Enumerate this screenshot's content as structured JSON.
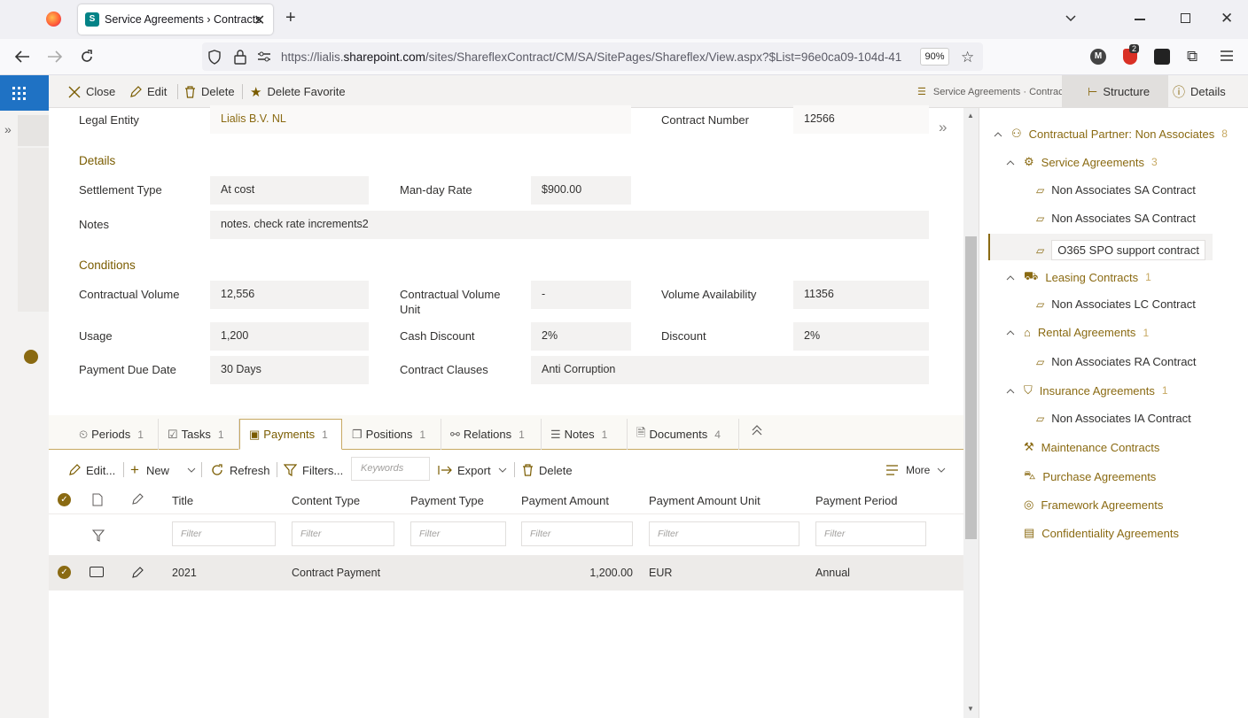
{
  "browser": {
    "tab_title": "Service Agreements › Contracts",
    "url_prefix": "https://lialis.",
    "url_domain": "sharepoint.com",
    "url_suffix": "/sites/ShareflexContract/CM/SA/SitePages/Shareflex/View.aspx?$List=96e0ca09-104d-41",
    "zoom": "90%",
    "ext_badge": "2",
    "profile_initial": "M"
  },
  "commands": {
    "close": "Close",
    "edit": "Edit",
    "delete": "Delete",
    "delete_favorite": "Delete Favorite",
    "breadcrumb": "Service Agreements · Contracts",
    "structure": "Structure",
    "details": "Details"
  },
  "form": {
    "legal_entity_label": "Legal Entity",
    "legal_entity_value": "Lialis B.V. NL",
    "contract_number_label": "Contract Number",
    "contract_number_value": "12566",
    "details_heading": "Details",
    "settlement_type_label": "Settlement Type",
    "settlement_type_value": "At cost",
    "manday_rate_label": "Man-day Rate",
    "manday_rate_value": "$900.00",
    "notes_label": "Notes",
    "notes_value": "notes. check rate increments2",
    "conditions_heading": "Conditions",
    "contractual_volume_label": "Contractual Volume",
    "contractual_volume_value": "12,556",
    "cv_unit_label_1": "Contractual Volume",
    "cv_unit_label_2": "Unit",
    "cv_unit_value": "-",
    "volume_availability_label": "Volume Availability",
    "volume_availability_value": "11356",
    "usage_label": "Usage",
    "usage_value": "1,200",
    "cash_discount_label": "Cash Discount",
    "cash_discount_value": "2%",
    "discount_label": "Discount",
    "discount_value": "2%",
    "payment_due_label": "Payment Due Date",
    "payment_due_value": "30 Days",
    "clauses_label": "Contract Clauses",
    "clauses_value": "Anti Corruption"
  },
  "tabs": [
    {
      "label": "Periods",
      "count": "1"
    },
    {
      "label": "Tasks",
      "count": "1"
    },
    {
      "label": "Payments",
      "count": "1"
    },
    {
      "label": "Positions",
      "count": "1"
    },
    {
      "label": "Relations",
      "count": "1"
    },
    {
      "label": "Notes",
      "count": "1"
    },
    {
      "label": "Documents",
      "count": "4"
    }
  ],
  "list_toolbar": {
    "edit": "Edit...",
    "new": "New",
    "refresh": "Refresh",
    "filters": "Filters...",
    "keywords_placeholder": "Keywords",
    "export": "Export",
    "delete": "Delete",
    "more": "More"
  },
  "table": {
    "headers": [
      "Title",
      "Content Type",
      "Payment Type",
      "Payment Amount",
      "Payment Amount Unit",
      "Payment Period"
    ],
    "filter_placeholder": "Filter",
    "rows": [
      {
        "title": "2021",
        "content_type": "Contract Payment",
        "payment_type": "",
        "amount": "1,200.00",
        "unit": "EUR",
        "period": "Annual"
      }
    ]
  },
  "structure": {
    "root": {
      "label": "Contractual Partner: Non Associates",
      "count": "8"
    },
    "groups": [
      {
        "label": "Service Agreements",
        "count": "3",
        "items": [
          "Non Associates SA Contract",
          "Non Associates SA Contract",
          "O365 SPO support contract"
        ]
      },
      {
        "label": "Leasing Contracts",
        "count": "1",
        "items": [
          "Non Associates LC Contract"
        ]
      },
      {
        "label": "Rental Agreements",
        "count": "1",
        "items": [
          "Non Associates RA Contract"
        ]
      },
      {
        "label": "Insurance Agreements",
        "count": "1",
        "items": [
          "Non Associates IA Contract"
        ]
      }
    ],
    "leaves": [
      "Maintenance Contracts",
      "Purchase Agreements",
      "Framework Agreements",
      "Confidentiality Agreements"
    ]
  },
  "colors": {
    "accent_gold": "#8a6a12",
    "sp_blue": "#1f72c4"
  }
}
